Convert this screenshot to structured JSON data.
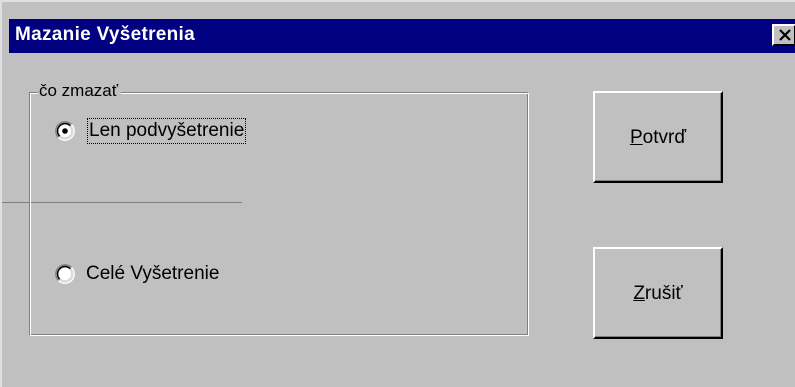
{
  "dialog": {
    "title": "Mazanie Vyšetrenia",
    "close_glyph": "close-icon"
  },
  "group": {
    "legend": "čo zmazať",
    "options": [
      {
        "label": "Len podvyšetrenie",
        "selected": true,
        "focused": true
      },
      {
        "label": "Celé Vyšetrenie",
        "selected": false,
        "focused": false
      }
    ]
  },
  "buttons": {
    "confirm": {
      "accel": "P",
      "rest": "otvrď"
    },
    "cancel": {
      "accel": "Z",
      "rest": "rušiť"
    }
  },
  "colors": {
    "face": "#c0c0c0",
    "titlebar": "#000080",
    "title_text": "#ffffff"
  }
}
